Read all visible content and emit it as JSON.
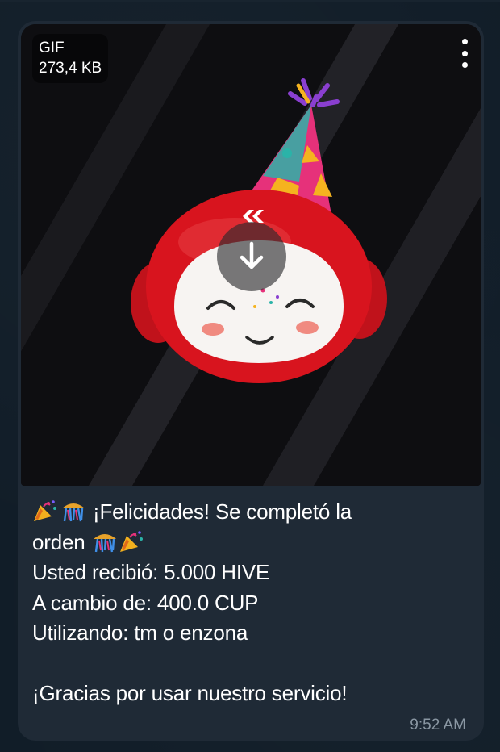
{
  "gif_badge": {
    "type_label": "GIF",
    "size_label": "273,4 KB"
  },
  "media": {
    "menu_icon": "more-vertical-icon",
    "download_icon": "download-arrow-icon",
    "art_description_icons": [
      "party-hat-icon",
      "mascot-face-icon",
      "hive-logo-icon"
    ]
  },
  "message": {
    "line1": "¡Felicidades! Se completó la",
    "line2": "orden",
    "line3": "Usted recibió: 5.000 HIVE",
    "line4": "A cambio de: 400.0 CUP",
    "line5": "Utilizando: tm o enzona",
    "line6": "¡Gracias por usar nuestro servicio!",
    "emojis": [
      "party-popper-icon",
      "confetti-ball-icon"
    ]
  },
  "timestamp": "9:52 AM",
  "colors": {
    "bubble": "#1f2a36",
    "background": "#111d28",
    "mascot_red": "#d8141e",
    "timestamp": "#8a97a3"
  }
}
